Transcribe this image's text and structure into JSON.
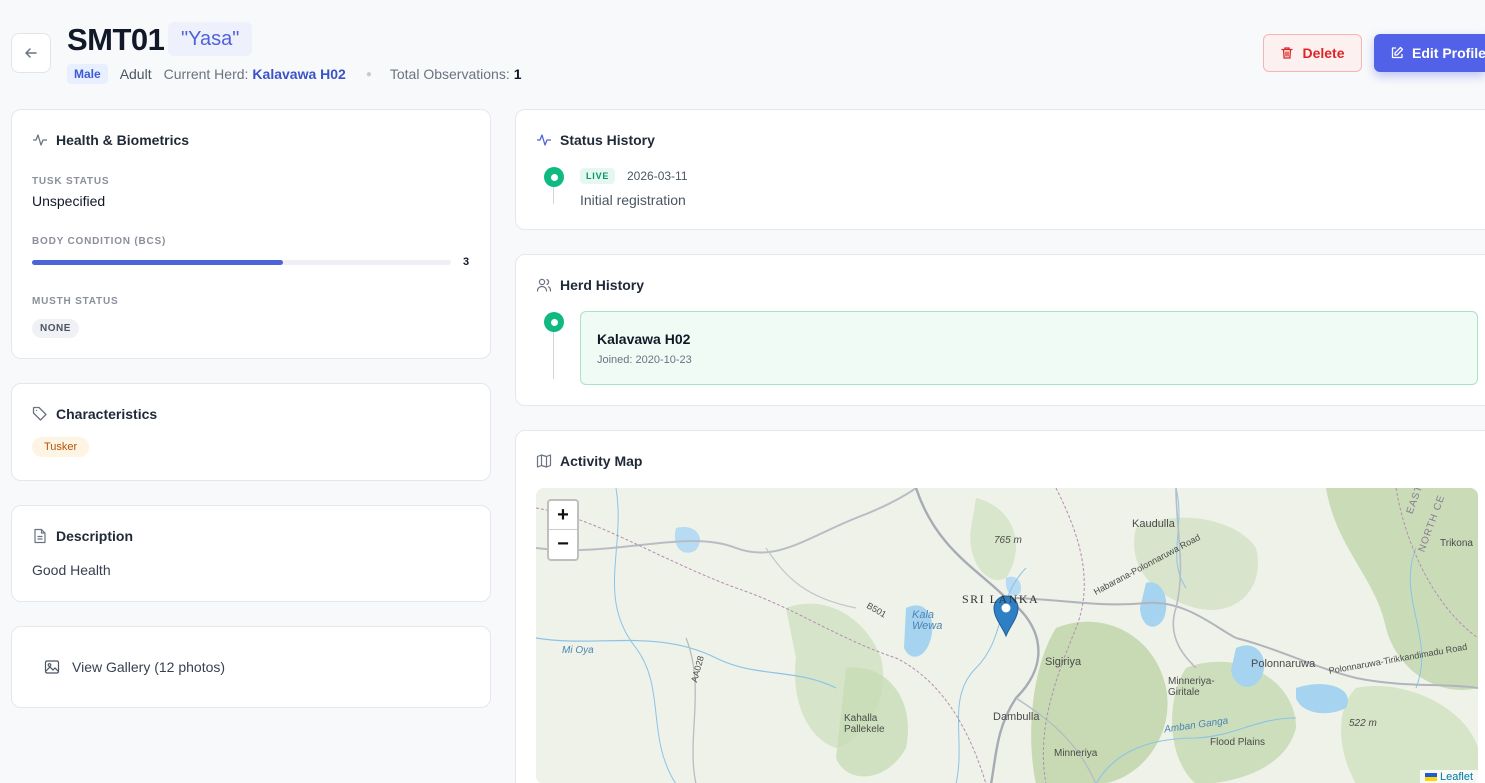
{
  "header": {
    "code": "SMT01",
    "nickname": "\"Yasa\"",
    "sex": "Male",
    "age": "Adult",
    "herd_label": "Current Herd:",
    "herd_value": "Kalavawa H02",
    "obs_label": "Total Observations:",
    "obs_value": "1",
    "delete_label": "Delete",
    "edit_label": "Edit Profile"
  },
  "health": {
    "title": "Health & Biometrics",
    "tusk_label": "TUSK STATUS",
    "tusk_value": "Unspecified",
    "bcs_label": "BODY CONDITION (BCS)",
    "bcs_value": "3",
    "bcs_fraction": 0.6,
    "musth_label": "MUSTH STATUS",
    "musth_value": "NONE"
  },
  "characteristics": {
    "title": "Characteristics",
    "tags": [
      "Tusker"
    ]
  },
  "description": {
    "title": "Description",
    "text": "Good Health"
  },
  "gallery": {
    "label": "View Gallery (12 photos)"
  },
  "status_history": {
    "title": "Status History",
    "entries": [
      {
        "status": "LIVE",
        "date": "2026-03-11",
        "note": "Initial registration"
      }
    ]
  },
  "herd_history": {
    "title": "Herd History",
    "entries": [
      {
        "name": "Kalavawa H02",
        "joined": "Joined: 2020-10-23"
      }
    ]
  },
  "activity_map": {
    "title": "Activity Map",
    "zoom_in": "+",
    "zoom_out": "−",
    "attribution": "Leaflet",
    "labels": {
      "country": "SRI LANKA",
      "kaudulla": "Kaudulla",
      "kala_wewa": "Kala\nWewa",
      "sigiriya": "Sigiriya",
      "polonnaruwa": "Polonnaruwa",
      "minneriya_giritale": "Minneriya-\nGiritale",
      "dambulla": "Dambulla",
      "kahalla": "Kahalla\nPallekele",
      "minneriya": "Minneriya",
      "flood_plains": "Flood Plains",
      "elev_765": "765 m",
      "elev_522": "522 m",
      "mi_oya": "Mi Oya",
      "amban_ganga": "Amban Ganga",
      "trikona": "Trikona",
      "habarana_road": "Habarana-Polonnaruwa Road",
      "b501": "B501",
      "aa028": "AA028",
      "east": "EAST",
      "north_central": "NORTH CE",
      "polonnaruwa_road": "Polonnaruwa-Tirikkandimadu Road"
    }
  },
  "colors": {
    "accent": "#5162e8",
    "live": "#10b981",
    "danger": "#dc2626",
    "marker": "#2f7fc4"
  }
}
